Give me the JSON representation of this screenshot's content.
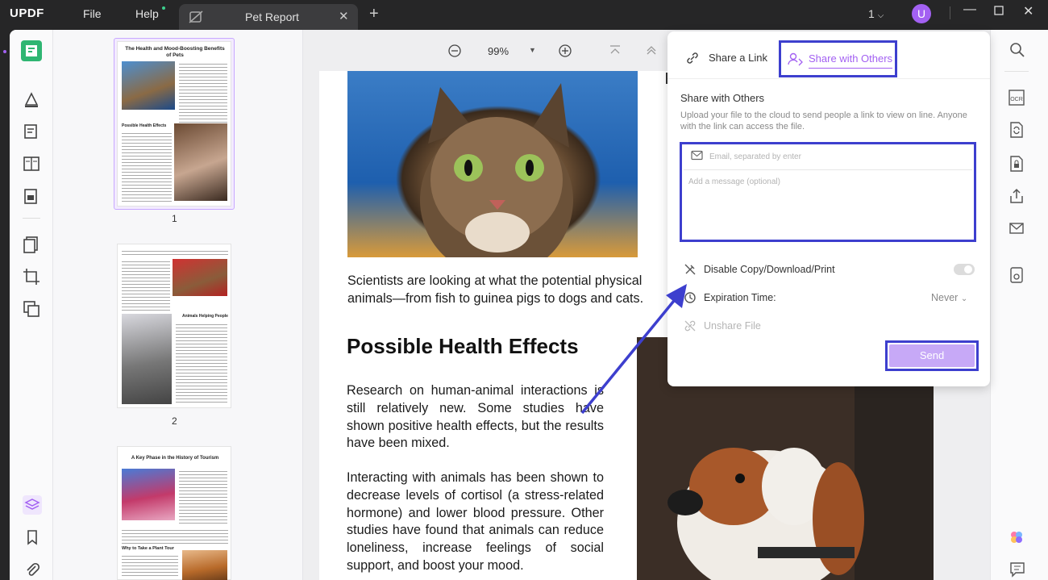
{
  "app": {
    "logo": "UPDF",
    "menu": [
      "File",
      "Help"
    ]
  },
  "tab": {
    "title": "Pet Report",
    "close": "✕",
    "new_tab": "+"
  },
  "titlebar": {
    "page_count": "1",
    "avatar_letter": "U"
  },
  "zoom": {
    "value": "99%"
  },
  "thumbnails": [
    {
      "page": "1",
      "title": "The Health and Mood-Boosting Benefits of Pets",
      "subheading": "Possible Health Effects"
    },
    {
      "page": "2",
      "subheading": "Animals Helping People"
    },
    {
      "title": "A Key Phase in the History of Tourism",
      "subheading": "Why to Take a Plant Tour"
    }
  ],
  "document": {
    "intro_text": "Scientists are looking at what the potential physical animals—from fish to guinea pigs to dogs and cats.",
    "heading": "Possible Health Effects",
    "paragraph1": "Research on human-animal interactions is still relatively new. Some studies have shown positive health effects, but the results have been mixed.",
    "paragraph2": "Interacting with animals has been shown to decrease levels of cortisol (a stress-related hormone) and lower blood pressure. Other studies have found that animals can reduce loneliness, increase feelings of social support, and boost your mood."
  },
  "share_dialog": {
    "tab_link": "Share a Link",
    "tab_others": "Share with Others",
    "heading": "Share with Others",
    "description": "Upload your file to the cloud to send people a link to view on line. Anyone with the link can access the file.",
    "email_placeholder": "Email, separated by enter",
    "message_placeholder": "Add a message (optional)",
    "disable_label": "Disable Copy/Download/Print",
    "disable_enabled": false,
    "expiration_label": "Expiration Time:",
    "expiration_value": "Never",
    "unshare_label": "Unshare File",
    "send_label": "Send"
  },
  "colors": {
    "accent": "#a361f2",
    "highlight_border": "#3d3fce",
    "send_button": "#c7a9f7"
  }
}
